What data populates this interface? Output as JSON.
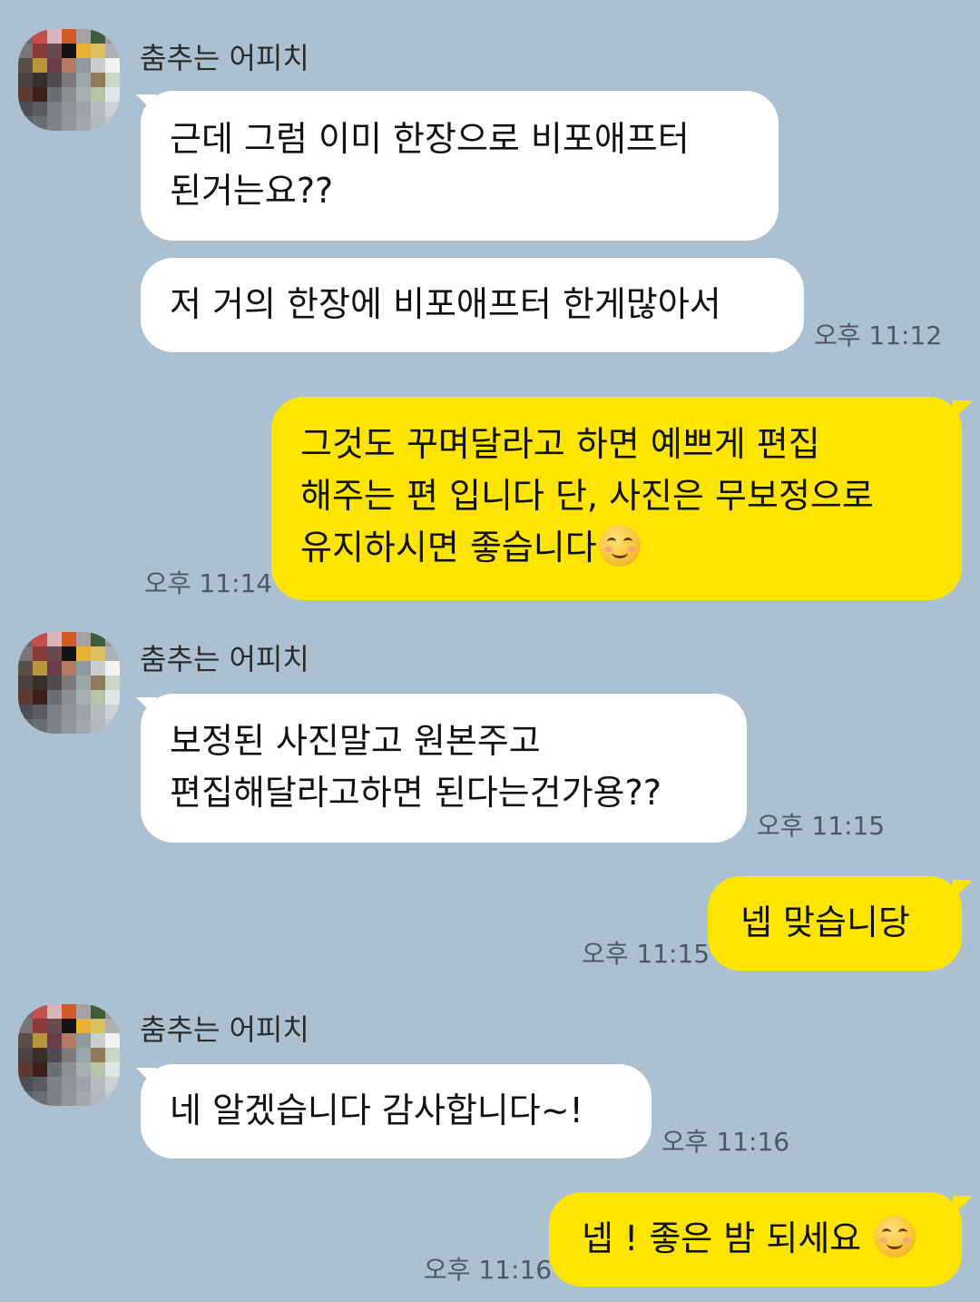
{
  "chat": {
    "sender_name": "춤추는 어피치",
    "colors": {
      "background": "#abc1d1",
      "incoming_bubble": "#ffffff",
      "outgoing_bubble": "#fee500"
    },
    "messages": [
      {
        "from": "other",
        "lines": [
          "근데 그럼 이미 한장으로 비포애프터",
          "된거는요??"
        ],
        "time": ""
      },
      {
        "from": "other",
        "lines": [
          "저 거의 한장에 비포애프터 한게많아서"
        ],
        "time": "오후 11:12"
      },
      {
        "from": "me",
        "lines": [
          "그것도 꾸며달라고 하면 예쁘게 편집",
          "해주는 편 입니다 단, 사진은 무보정으로",
          "유지하시면 좋습니다"
        ],
        "emoji": "smiling-face-icon",
        "time": "오후 11:14"
      },
      {
        "from": "other",
        "lines": [
          "보정된 사진말고 원본주고",
          "편집해달라고하면 된다는건가용??"
        ],
        "time": "오후 11:15"
      },
      {
        "from": "me",
        "lines": [
          "넵 맞습니당"
        ],
        "time": "오후 11:15"
      },
      {
        "from": "other",
        "lines": [
          "네 알겠습니다 감사합니다~!"
        ],
        "time": "오후 11:16"
      },
      {
        "from": "me",
        "lines": [
          "넵 ! 좋은 밤 되세요 "
        ],
        "emoji": "smiling-face-icon",
        "time": "오후 11:16"
      }
    ]
  }
}
